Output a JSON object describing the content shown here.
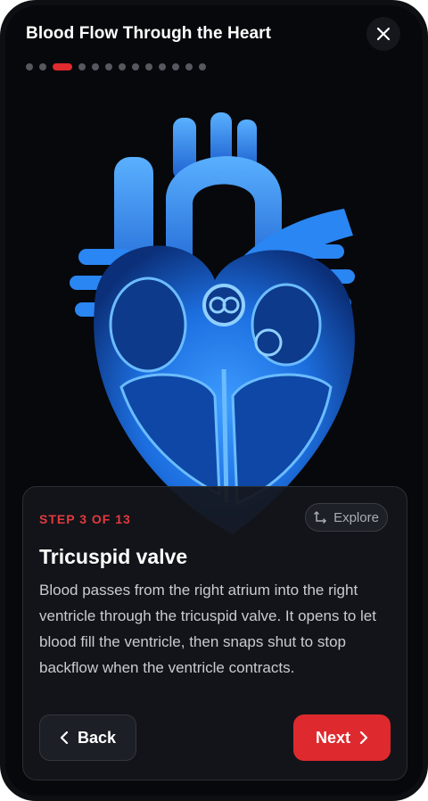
{
  "header": {
    "title": "Blood Flow Through the Heart",
    "close_icon": "close-icon"
  },
  "progress": {
    "total_steps": 13,
    "current_step": 3
  },
  "illustration": {
    "name": "heart-cross-section-illustration",
    "accent_color": "#1e7ff0"
  },
  "card": {
    "step_label": "STEP 3 OF 13",
    "explore_label": "Explore",
    "explore_icon": "arrows-expand-icon",
    "heading": "Tricuspid valve",
    "description": "Blood passes from the right atrium into the right ventricle through the tricuspid valve. It opens to let blood fill the ventricle, then snaps shut to stop backflow when the ventricle contracts.",
    "back_label": "Back",
    "next_label": "Next"
  },
  "colors": {
    "accent": "#de2a2e",
    "background": "#07080b",
    "card": "#14161b"
  }
}
